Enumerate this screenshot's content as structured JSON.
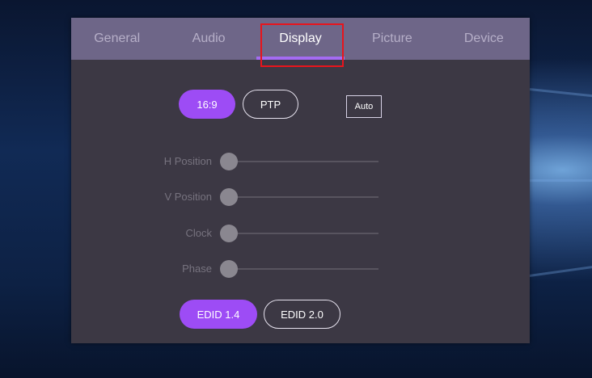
{
  "tabs": [
    {
      "label": "General"
    },
    {
      "label": "Audio"
    },
    {
      "label": "Display"
    },
    {
      "label": "Picture"
    },
    {
      "label": "Device"
    }
  ],
  "active_tab": "Display",
  "aspect": {
    "options": [
      {
        "label": "16:9",
        "selected": true
      },
      {
        "label": "PTP",
        "selected": false
      }
    ],
    "auto_label": "Auto"
  },
  "sliders": [
    {
      "label": "H Position",
      "value": 0
    },
    {
      "label": "V Position",
      "value": 0
    },
    {
      "label": "Clock",
      "value": 0
    },
    {
      "label": "Phase",
      "value": 0
    }
  ],
  "edid": {
    "options": [
      {
        "label": "EDID 1.4",
        "selected": true
      },
      {
        "label": "EDID 2.0",
        "selected": false
      }
    ]
  },
  "colors": {
    "accent": "#9d4cf5",
    "tab_bar": "#6e6688",
    "panel": "#3c3844",
    "highlight": "#e8141c"
  }
}
